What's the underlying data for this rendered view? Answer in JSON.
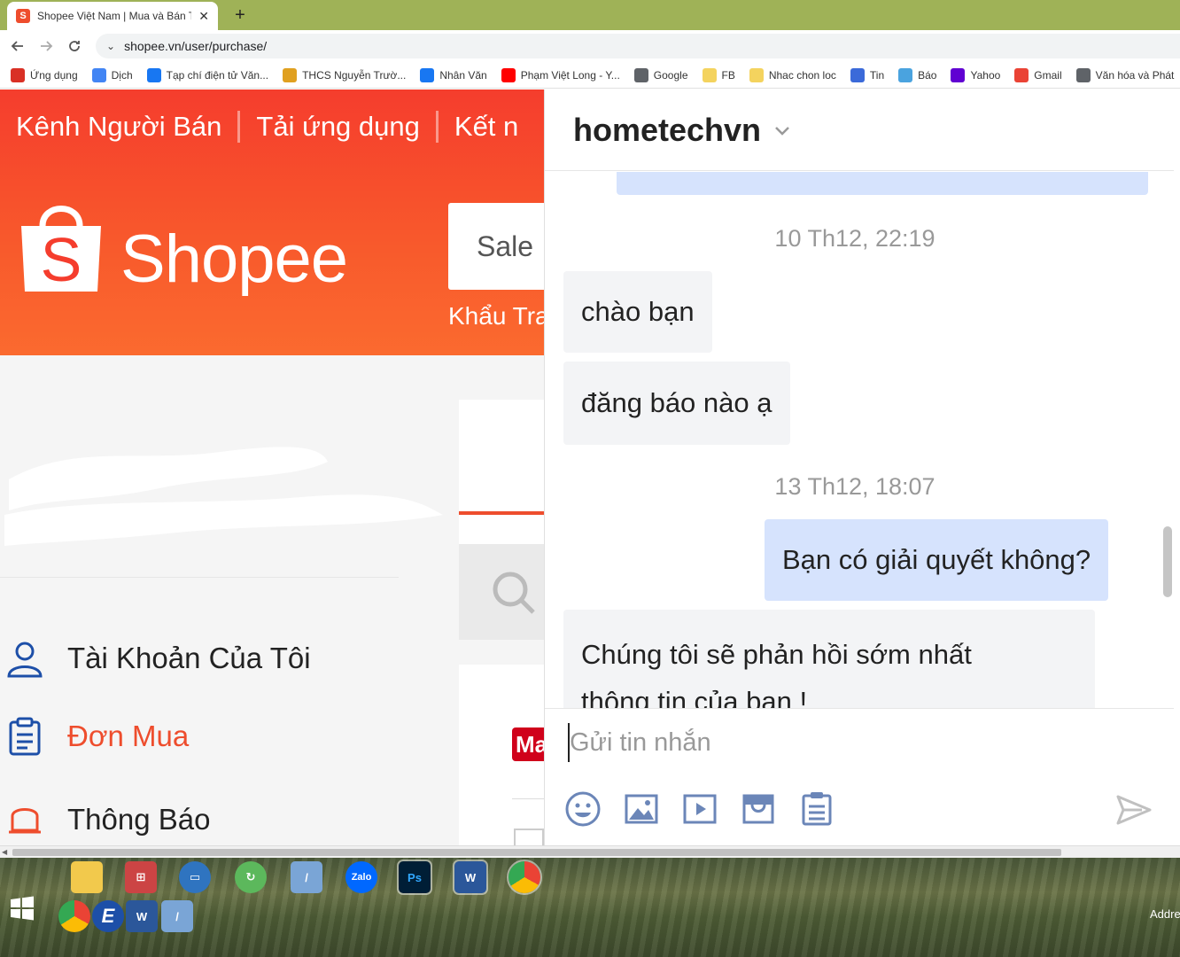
{
  "browser": {
    "tab_title": "Shopee Việt Nam | Mua và Bán Tr",
    "url": "shopee.vn/user/purchase/",
    "bookmarks": [
      {
        "label": "Ứng dụng",
        "color": "#d93025"
      },
      {
        "label": "Dịch",
        "color": "#4285f4"
      },
      {
        "label": "Tạp chí điện tử Văn...",
        "color": "#1877f2"
      },
      {
        "label": "THCS Nguyễn Trườ...",
        "color": "#e0a020"
      },
      {
        "label": "Nhân Văn",
        "color": "#1877f2"
      },
      {
        "label": "Phạm Việt Long - Y...",
        "color": "#ff0000"
      },
      {
        "label": "Google",
        "color": "#5f6368"
      },
      {
        "label": "FB",
        "color": "#f4d35e"
      },
      {
        "label": "Nhac chon loc",
        "color": "#f4d35e"
      },
      {
        "label": "Tin",
        "color": "#3b6ad9"
      },
      {
        "label": "Báo",
        "color": "#4aa3df"
      },
      {
        "label": "Yahoo",
        "color": "#6001d2"
      },
      {
        "label": "Gmail",
        "color": "#ea4335"
      },
      {
        "label": "Văn hóa và Phát",
        "color": "#5f6368"
      }
    ]
  },
  "shopee": {
    "topnav": [
      "Kênh Người Bán",
      "Tải ứng dụng",
      "Kết n"
    ],
    "logo_text": "Shopee",
    "search_text": "Sale",
    "sub_link": "Khẩu Tra",
    "menu": [
      {
        "label": "Tài Khoản Của Tôi",
        "icon": "user-icon",
        "active": false
      },
      {
        "label": "Đơn Mua",
        "icon": "clipboard-icon",
        "active": true
      },
      {
        "label": "Thông Báo",
        "icon": "bell-icon",
        "active": false
      }
    ],
    "mall_badge": "Ma",
    "accent": "#ee4d2d"
  },
  "chat": {
    "title": "hometechvn",
    "timestamps": [
      "10 Th12, 22:19",
      "13 Th12, 18:07"
    ],
    "messages": [
      {
        "text": "chào bạn",
        "direction": "in"
      },
      {
        "text": "đăng báo nào ạ",
        "direction": "in"
      },
      {
        "text": "Bạn có giải quyết không?",
        "direction": "out"
      },
      {
        "text": "Chúng tôi sẽ phản hồi sớm nhất",
        "direction": "in"
      },
      {
        "text": "thông tin của bạn !",
        "direction": "in"
      }
    ],
    "input_placeholder": "Gửi tin nhắn",
    "tools": [
      "emoji-icon",
      "image-icon",
      "video-icon",
      "shop-icon",
      "order-icon"
    ],
    "bubble_out_color": "#d6e3fd",
    "bubble_in_color": "#f3f4f6"
  },
  "taskbar": {
    "icons": [
      "folder",
      "network",
      "remote-desktop",
      "cloud",
      "scanner",
      "Zalo",
      "Ps",
      "W",
      "chrome"
    ],
    "quick_icons": [
      "chrome",
      "E",
      "word",
      "scanner"
    ],
    "addr_label": "Addre"
  }
}
